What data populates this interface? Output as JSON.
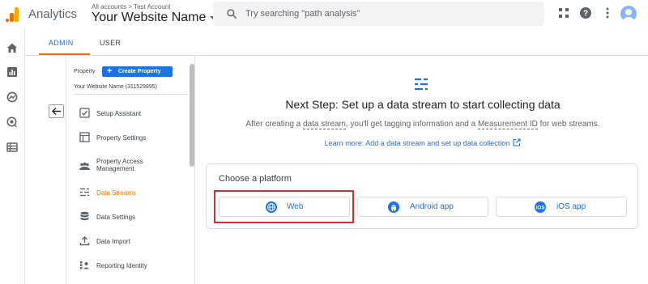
{
  "header": {
    "app_name": "Analytics",
    "breadcrumb_all": "All accounts",
    "breadcrumb_sep": " > ",
    "breadcrumb_account": "Test Account",
    "property_name": "Your Website Name",
    "search_placeholder": "Try searching \"path analysis\""
  },
  "tabs": {
    "admin": "ADMIN",
    "user": "USER"
  },
  "property_panel": {
    "label": "Property",
    "create_button": "Create Property",
    "property_name_id": "Your Website Name (311529895)",
    "menu": [
      {
        "label": "Setup Assistant",
        "icon": "checklist-icon"
      },
      {
        "label": "Property Settings",
        "icon": "property-settings-icon"
      },
      {
        "label": "Property Access Management",
        "icon": "people-icon"
      },
      {
        "label": "Data Streams",
        "icon": "data-streams-icon",
        "active": true
      },
      {
        "label": "Data Settings",
        "icon": "database-icon"
      },
      {
        "label": "Data Import",
        "icon": "upload-icon"
      },
      {
        "label": "Reporting Identity",
        "icon": "reporting-identity-icon"
      }
    ]
  },
  "main": {
    "title": "Next Step: Set up a data stream to start collecting data",
    "subtitle_a": "After creating a ",
    "subtitle_link1": "data stream",
    "subtitle_b": ", you'll get tagging information and a ",
    "subtitle_link2": "Measurement ID",
    "subtitle_c": " for web streams.",
    "learn_more": "Learn more: Add a data stream and set up data collection",
    "choose_platform": "Choose a platform",
    "platforms": [
      {
        "label": "Web",
        "icon": "globe-icon"
      },
      {
        "label": "Android app",
        "icon": "android-icon"
      },
      {
        "label": "iOS app",
        "icon": "ios-icon"
      }
    ]
  },
  "colors": {
    "accent_blue": "#1a73e8",
    "ga_orange": "#e37400",
    "highlight_red": "#d32f2f"
  }
}
